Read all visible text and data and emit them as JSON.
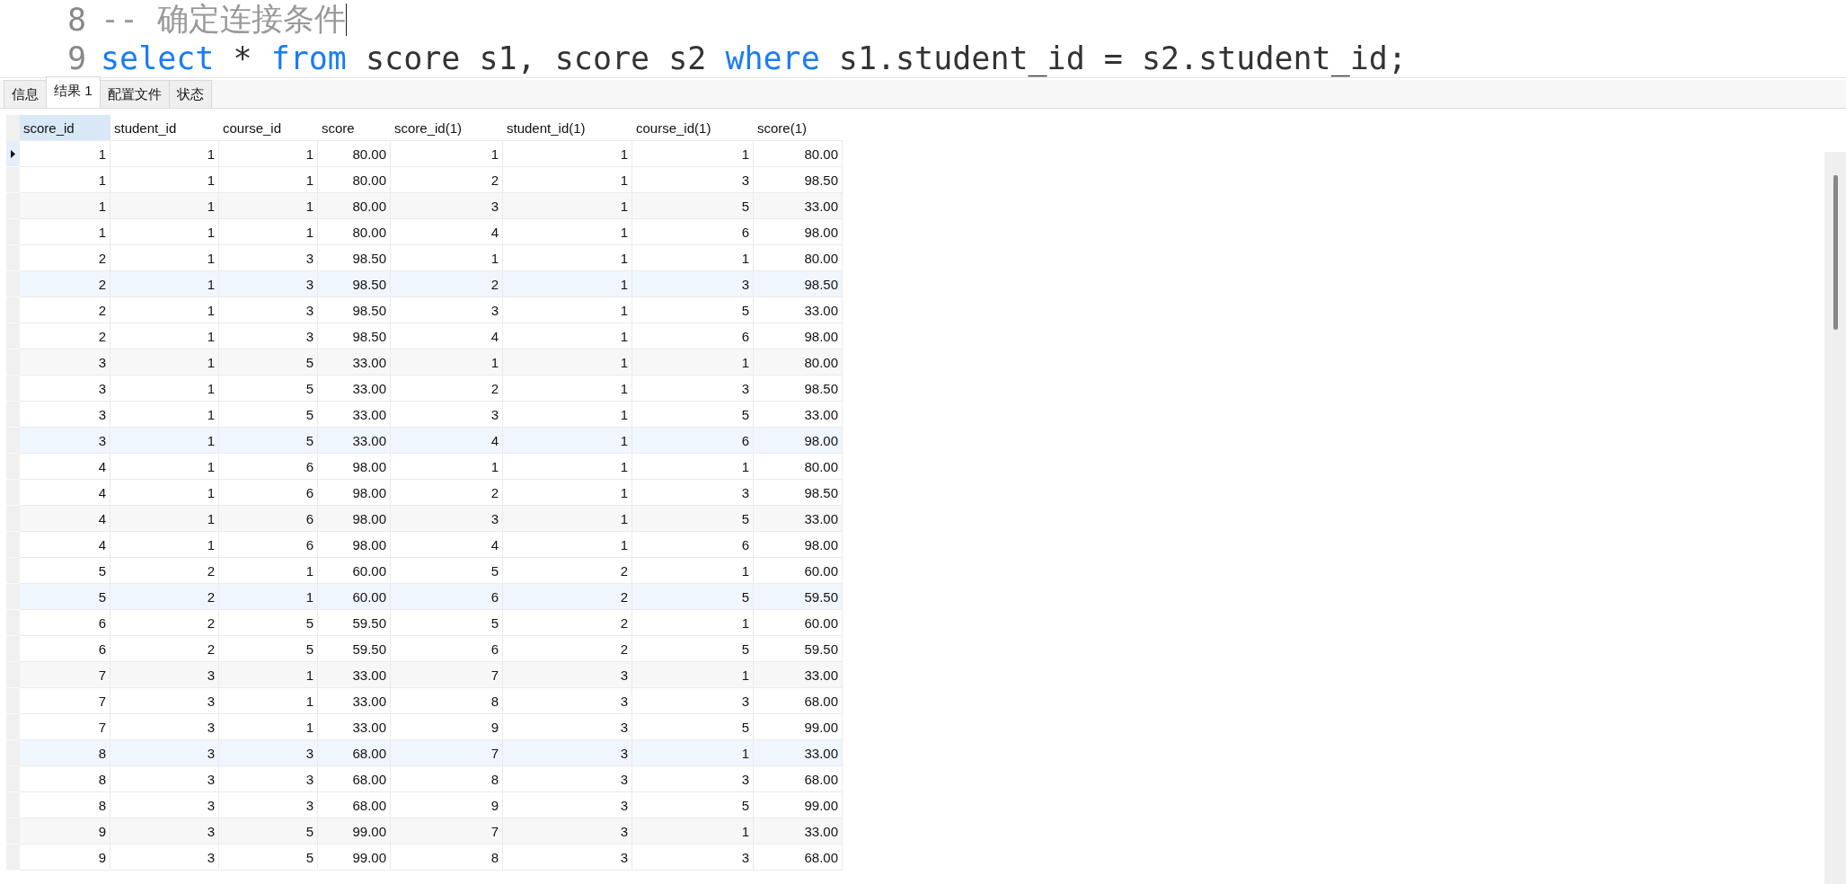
{
  "editor": {
    "lines": [
      {
        "number": "8",
        "caret": true,
        "tokens": [
          {
            "kind": "comment",
            "text": "-- 确定连接条件"
          }
        ]
      },
      {
        "number": "9",
        "caret": false,
        "tokens": [
          {
            "kind": "keyword",
            "text": "select"
          },
          {
            "kind": "plain",
            "text": " * "
          },
          {
            "kind": "keyword",
            "text": "from"
          },
          {
            "kind": "plain",
            "text": " score s1, score s2 "
          },
          {
            "kind": "keyword",
            "text": "where"
          },
          {
            "kind": "plain",
            "text": " s1.student_id = s2.student_id;"
          }
        ]
      }
    ]
  },
  "tabs": [
    {
      "label": "信息",
      "selected": false
    },
    {
      "label": "结果 1",
      "selected": true
    },
    {
      "label": "配置文件",
      "selected": false
    },
    {
      "label": "状态",
      "selected": false
    }
  ],
  "table": {
    "columns": [
      {
        "label": "score_id",
        "selected": true
      },
      {
        "label": "student_id",
        "selected": false
      },
      {
        "label": "course_id",
        "selected": false
      },
      {
        "label": "score",
        "selected": false
      },
      {
        "label": "score_id(1)",
        "selected": false
      },
      {
        "label": "student_id(1)",
        "selected": false
      },
      {
        "label": "course_id(1)",
        "selected": false
      },
      {
        "label": "score(1)",
        "selected": false
      }
    ],
    "rows": [
      {
        "selected": true,
        "cells": [
          "1",
          "1",
          "1",
          "80.00",
          "1",
          "1",
          "1",
          "80.00"
        ]
      },
      {
        "selected": false,
        "cells": [
          "1",
          "1",
          "1",
          "80.00",
          "2",
          "1",
          "3",
          "98.50"
        ]
      },
      {
        "selected": false,
        "cells": [
          "1",
          "1",
          "1",
          "80.00",
          "3",
          "1",
          "5",
          "33.00"
        ]
      },
      {
        "selected": false,
        "cells": [
          "1",
          "1",
          "1",
          "80.00",
          "4",
          "1",
          "6",
          "98.00"
        ]
      },
      {
        "selected": false,
        "cells": [
          "2",
          "1",
          "3",
          "98.50",
          "1",
          "1",
          "1",
          "80.00"
        ]
      },
      {
        "selected": false,
        "cells": [
          "2",
          "1",
          "3",
          "98.50",
          "2",
          "1",
          "3",
          "98.50"
        ]
      },
      {
        "selected": false,
        "cells": [
          "2",
          "1",
          "3",
          "98.50",
          "3",
          "1",
          "5",
          "33.00"
        ]
      },
      {
        "selected": false,
        "cells": [
          "2",
          "1",
          "3",
          "98.50",
          "4",
          "1",
          "6",
          "98.00"
        ]
      },
      {
        "selected": false,
        "cells": [
          "3",
          "1",
          "5",
          "33.00",
          "1",
          "1",
          "1",
          "80.00"
        ]
      },
      {
        "selected": false,
        "cells": [
          "3",
          "1",
          "5",
          "33.00",
          "2",
          "1",
          "3",
          "98.50"
        ]
      },
      {
        "selected": false,
        "cells": [
          "3",
          "1",
          "5",
          "33.00",
          "3",
          "1",
          "5",
          "33.00"
        ]
      },
      {
        "selected": false,
        "cells": [
          "3",
          "1",
          "5",
          "33.00",
          "4",
          "1",
          "6",
          "98.00"
        ]
      },
      {
        "selected": false,
        "cells": [
          "4",
          "1",
          "6",
          "98.00",
          "1",
          "1",
          "1",
          "80.00"
        ]
      },
      {
        "selected": false,
        "cells": [
          "4",
          "1",
          "6",
          "98.00",
          "2",
          "1",
          "3",
          "98.50"
        ]
      },
      {
        "selected": false,
        "cells": [
          "4",
          "1",
          "6",
          "98.00",
          "3",
          "1",
          "5",
          "33.00"
        ]
      },
      {
        "selected": false,
        "cells": [
          "4",
          "1",
          "6",
          "98.00",
          "4",
          "1",
          "6",
          "98.00"
        ]
      },
      {
        "selected": false,
        "cells": [
          "5",
          "2",
          "1",
          "60.00",
          "5",
          "2",
          "1",
          "60.00"
        ]
      },
      {
        "selected": false,
        "cells": [
          "5",
          "2",
          "1",
          "60.00",
          "6",
          "2",
          "5",
          "59.50"
        ]
      },
      {
        "selected": false,
        "cells": [
          "6",
          "2",
          "5",
          "59.50",
          "5",
          "2",
          "1",
          "60.00"
        ]
      },
      {
        "selected": false,
        "cells": [
          "6",
          "2",
          "5",
          "59.50",
          "6",
          "2",
          "5",
          "59.50"
        ]
      },
      {
        "selected": false,
        "cells": [
          "7",
          "3",
          "1",
          "33.00",
          "7",
          "3",
          "1",
          "33.00"
        ]
      },
      {
        "selected": false,
        "cells": [
          "7",
          "3",
          "1",
          "33.00",
          "8",
          "3",
          "3",
          "68.00"
        ]
      },
      {
        "selected": false,
        "cells": [
          "7",
          "3",
          "1",
          "33.00",
          "9",
          "3",
          "5",
          "99.00"
        ]
      },
      {
        "selected": false,
        "cells": [
          "8",
          "3",
          "3",
          "68.00",
          "7",
          "3",
          "1",
          "33.00"
        ]
      },
      {
        "selected": false,
        "cells": [
          "8",
          "3",
          "3",
          "68.00",
          "8",
          "3",
          "3",
          "68.00"
        ]
      },
      {
        "selected": false,
        "cells": [
          "8",
          "3",
          "3",
          "68.00",
          "9",
          "3",
          "5",
          "99.00"
        ]
      },
      {
        "selected": false,
        "cells": [
          "9",
          "3",
          "5",
          "99.00",
          "7",
          "3",
          "1",
          "33.00"
        ]
      },
      {
        "selected": false,
        "cells": [
          "9",
          "3",
          "5",
          "99.00",
          "8",
          "3",
          "3",
          "68.00"
        ]
      }
    ]
  }
}
